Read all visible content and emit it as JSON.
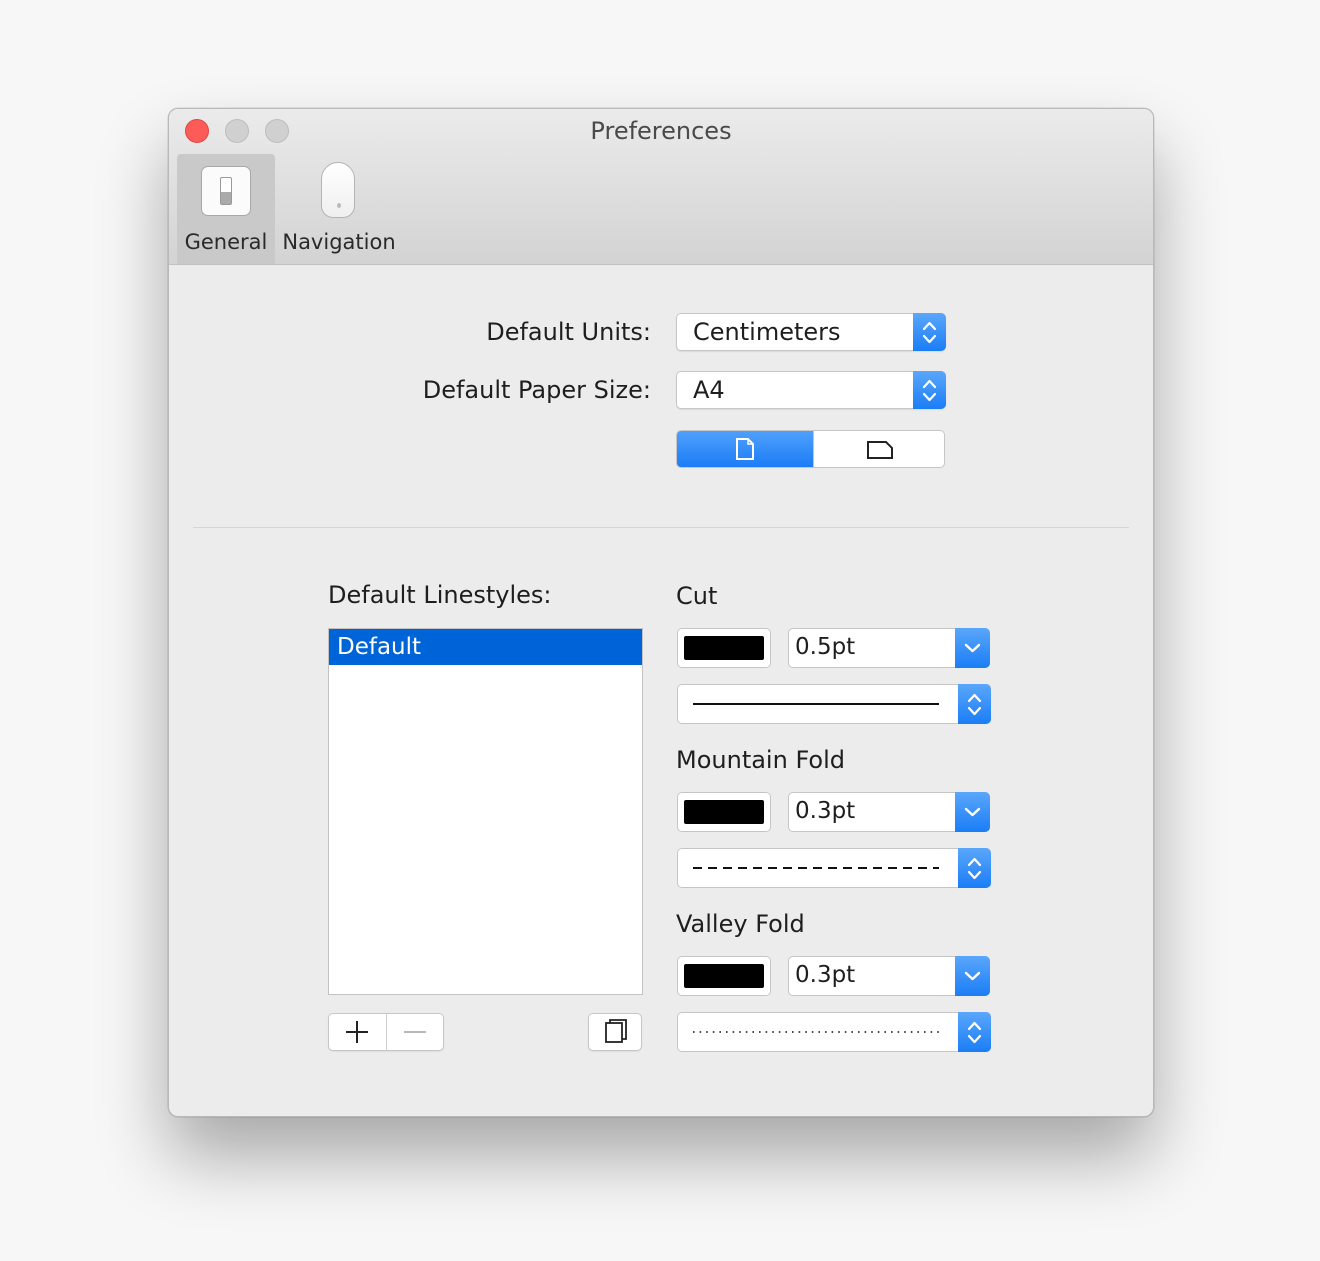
{
  "window": {
    "title": "Preferences"
  },
  "toolbar": {
    "items": [
      {
        "label": "General",
        "icon": "general-switch-icon",
        "selected": true
      },
      {
        "label": "Navigation",
        "icon": "mouse-icon",
        "selected": false
      }
    ]
  },
  "general": {
    "units_label": "Default Units:",
    "units_value": "Centimeters",
    "paper_label": "Default Paper Size:",
    "paper_value": "A4",
    "orientation_selected": "portrait"
  },
  "linestyles": {
    "heading": "Default Linestyles:",
    "items": [
      "Default"
    ],
    "selected_index": 0
  },
  "styles": {
    "cut": {
      "label": "Cut",
      "color": "#000000",
      "width": "0.5pt",
      "pattern": "solid"
    },
    "mountain": {
      "label": "Mountain Fold",
      "color": "#000000",
      "width": "0.3pt",
      "pattern": "dashed"
    },
    "valley": {
      "label": "Valley Fold",
      "color": "#000000",
      "width": "0.3pt",
      "pattern": "dotted"
    }
  },
  "colors": {
    "accent": "#1b7df6",
    "selection": "#0064d9",
    "close": "#fc5b57"
  }
}
